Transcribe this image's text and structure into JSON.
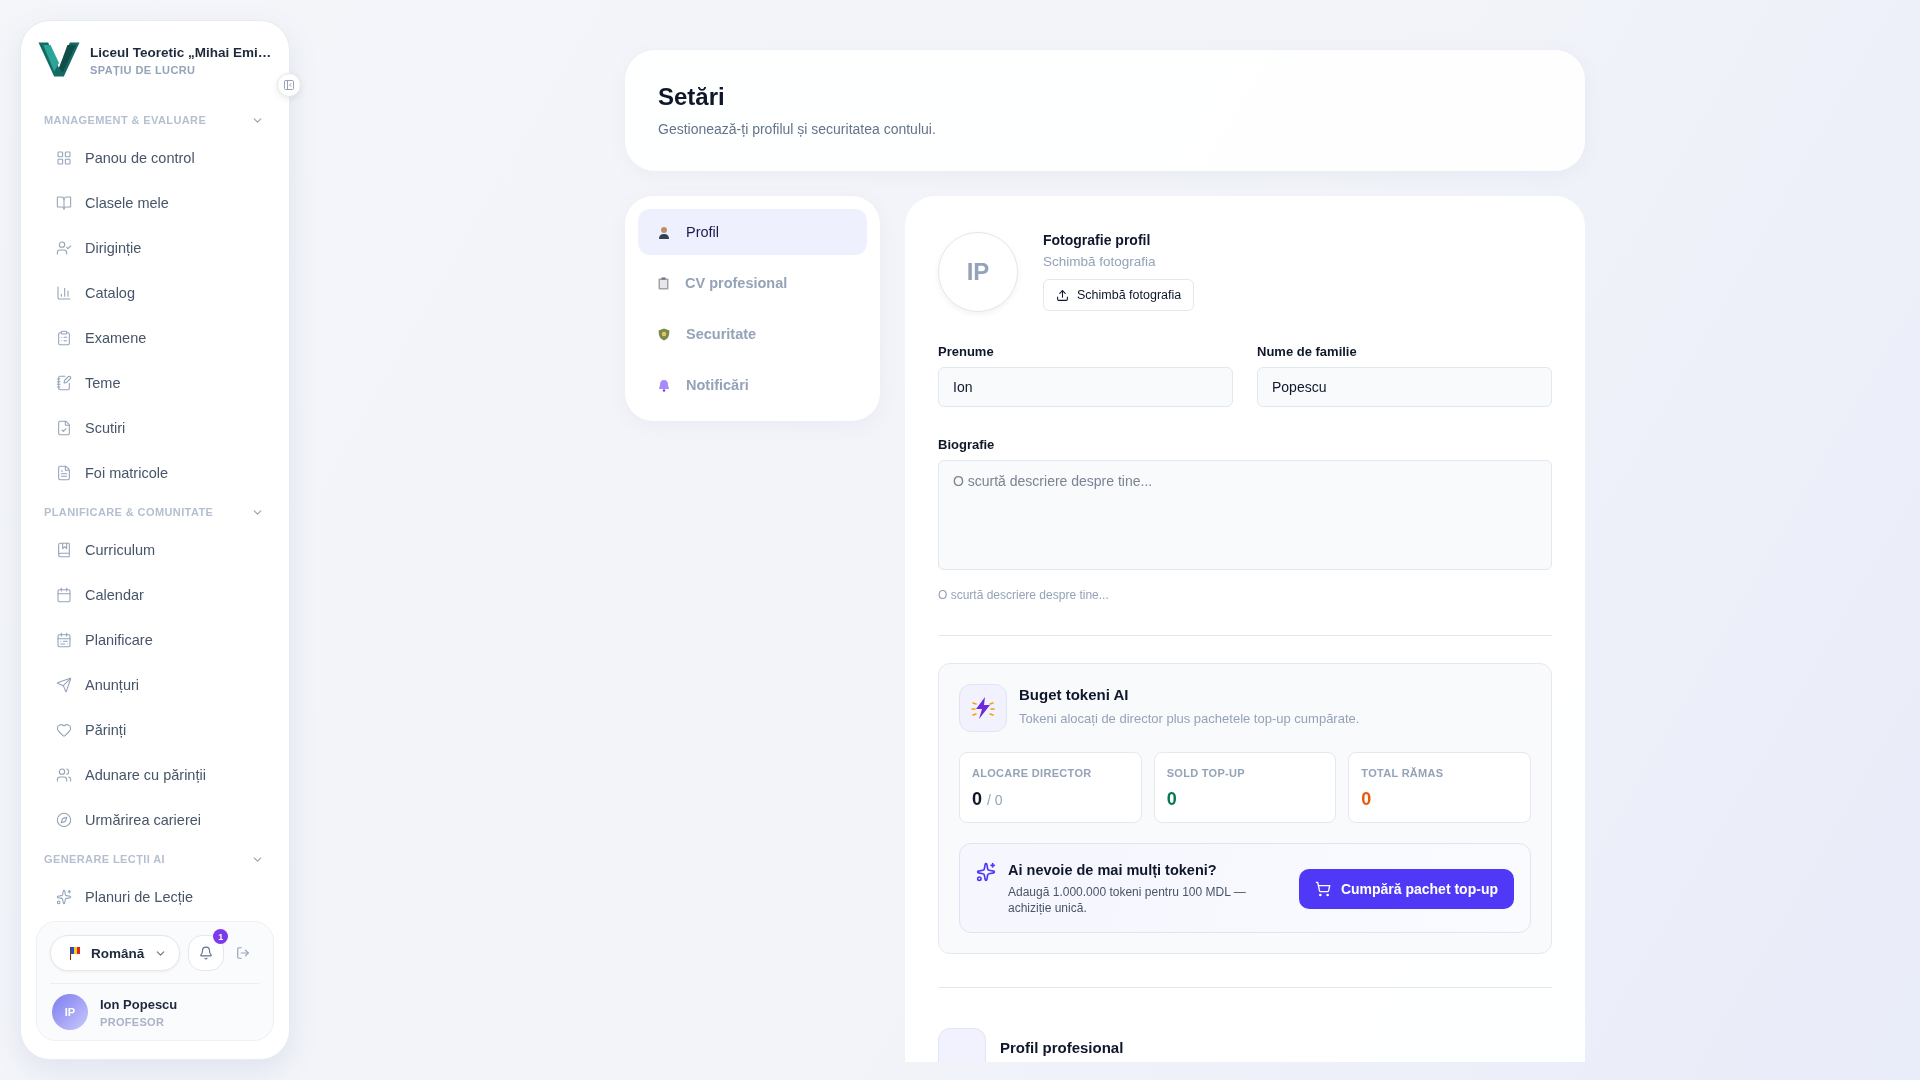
{
  "sidebar": {
    "school": "Liceul Teoretic „Mihai Emi…",
    "workspace": "SPAȚIU DE LUCRU",
    "groups": [
      {
        "title": "MANAGEMENT & EVALUARE",
        "expanded": true,
        "items": [
          "Panou de control",
          "Clasele mele",
          "Diriginție",
          "Catalog",
          "Examene",
          "Teme",
          "Scutiri",
          "Foi matricole"
        ]
      },
      {
        "title": "PLANIFICARE & COMUNITATE",
        "expanded": true,
        "items": [
          "Curriculum",
          "Calendar",
          "Planificare",
          "Anunțuri",
          "Părinți",
          "Adunare cu părinții",
          "Urmărirea carierei"
        ]
      },
      {
        "title": "GENERARE LECȚII AI",
        "expanded": true,
        "items": [
          "Planuri de Lecție"
        ]
      }
    ],
    "language": "Română",
    "notification_count": "1",
    "user": {
      "initials": "IP",
      "name": "Ion Popescu",
      "role": "PROFESOR"
    }
  },
  "header": {
    "title": "Setări",
    "subtitle": "Gestionează-ți profilul și securitatea contului."
  },
  "tabs": [
    {
      "label": "Profil",
      "selected": true
    },
    {
      "label": "CV profesional",
      "selected": false
    },
    {
      "label": "Securitate",
      "selected": false
    },
    {
      "label": "Notificări",
      "selected": false
    }
  ],
  "profile": {
    "initials": "IP",
    "photo_title": "Fotografie profil",
    "photo_subtitle": "Schimbă fotografia",
    "change_button": "Schimbă fotografia",
    "first_name": {
      "label": "Prenume",
      "value": "Ion"
    },
    "last_name": {
      "label": "Nume de familie",
      "value": "Popescu"
    },
    "bio": {
      "label": "Biografie",
      "placeholder": "O scurtă descriere despre tine...",
      "hint": "O scurtă descriere despre tine..."
    }
  },
  "token_budget": {
    "title": "Buget tokeni AI",
    "subtitle": "Tokeni alocați de director plus pachetele top-up cumpărate.",
    "stats": [
      {
        "label": "ALOCARE DIRECTOR",
        "value": "0",
        "total": "/ 0",
        "color": "#0f172a"
      },
      {
        "label": "SOLD TOP-UP",
        "value": "0",
        "color": "#047857"
      },
      {
        "label": "TOTAL RĂMAS",
        "value": "0",
        "color": "#ea580c"
      }
    ],
    "topup": {
      "title": "Ai nevoie de mai mulți tokeni?",
      "text": "Adaugă 1.000.000 tokeni pentru 100 MDL — achiziție unică.",
      "button": "Cumpără pachet top-up"
    }
  },
  "next_section": {
    "title": "Profil profesional"
  }
}
